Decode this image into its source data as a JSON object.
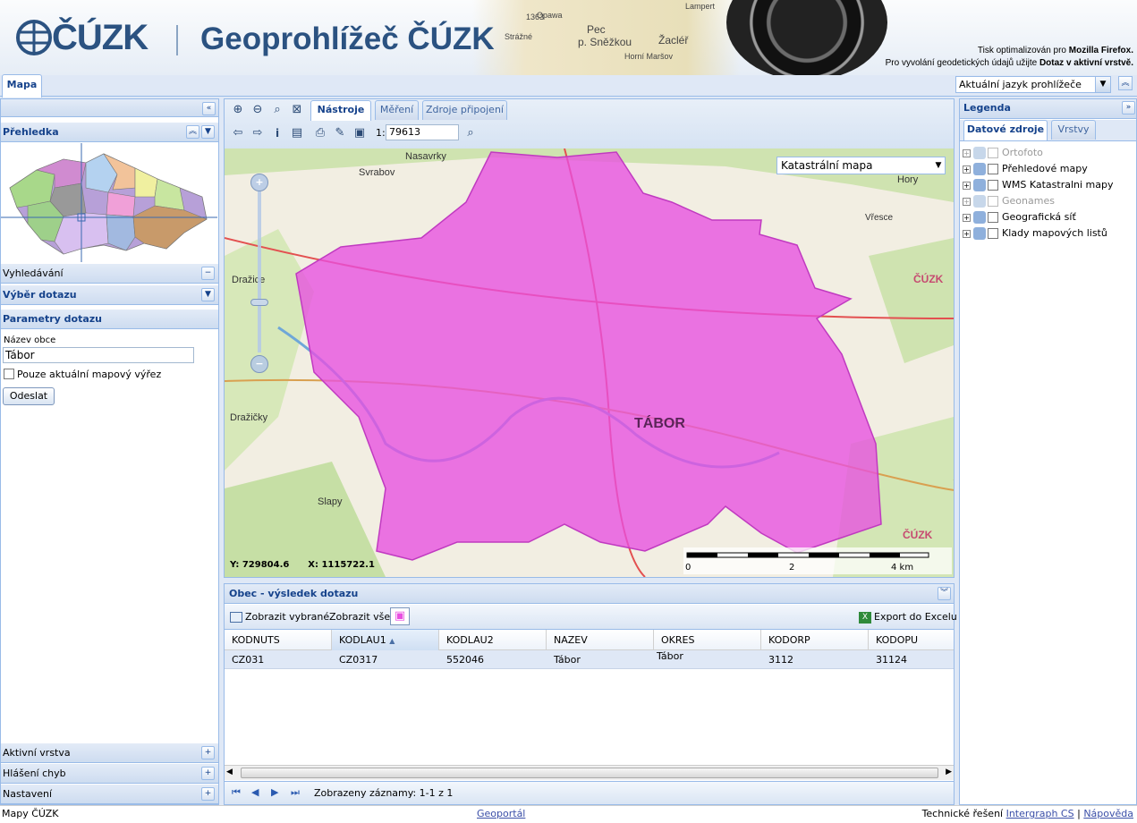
{
  "header": {
    "logo_text": "ČÚZK",
    "title": "Geoprohlížeč ČÚZK",
    "map_labels": [
      "Pec",
      "p. Sněžkou",
      "Strážné",
      "1363",
      "Žacléř",
      "Horní Maršov",
      "Opawa",
      "Lampert"
    ],
    "note_line1_prefix": "Tisk optimalizován pro ",
    "note_line1_bold": "Mozilla Firefox.",
    "note_line2_prefix": "Pro vyvolání geodetických údajů užijte ",
    "note_line2_bold": "Dotaz v aktivní vrstvě."
  },
  "main_tab": "Mapa",
  "language_select": "Aktuální jazyk prohlížeče",
  "left": {
    "overview_title": "Přehledka",
    "search_title": "Vyhledávání",
    "query_select_title": "Výběr dotazu",
    "params_title": "Parametry dotazu",
    "field_label": "Název obce",
    "field_value": "Tábor",
    "checkbox_label": "Pouze aktuální mapový výřez",
    "submit_label": "Odeslat",
    "bottom_panels": [
      "Aktivní vrstva",
      "Hlášení chyb",
      "Nastavení"
    ]
  },
  "center": {
    "tabs": [
      "Nástroje",
      "Měření",
      "Zdroje připojení"
    ],
    "scale_prefix": "1:",
    "scale_value": "79613",
    "layer_select": "Katastrální mapa",
    "coord_y": "Y: 729804.6",
    "coord_x": "X: 1115722.1",
    "scalebar_labels": [
      "0",
      "2",
      "4 km"
    ],
    "map_labels": [
      "TÁBOR",
      "Nasavrky",
      "Svrabov",
      "Dražice",
      "Dražičky",
      "Slapy",
      "Hory",
      "Vřesce",
      "ČÚZK",
      "ČÚZK"
    ]
  },
  "results": {
    "title": "Obec - výsledek dotazu",
    "show_selected": "Zobrazit vybrané",
    "show_all": "Zobrazit vše",
    "export": "Export do Excelu",
    "columns": [
      "KODNUTS",
      "KODLAU1",
      "KODLAU2",
      "NAZEV",
      "OKRES",
      "KODORP",
      "KODOPU"
    ],
    "rows": [
      [
        "CZ031",
        "CZ0317",
        "552046",
        "Tábor",
        "Tábor",
        "3112",
        "31124"
      ]
    ],
    "pager_text": "Zobrazeny záznamy: 1-1 z 1"
  },
  "right": {
    "title": "Legenda",
    "tabs": [
      "Datové zdroje",
      "Vrstvy"
    ],
    "items": [
      {
        "label": "Ortofoto",
        "disabled": true
      },
      {
        "label": "Přehledové mapy",
        "disabled": false
      },
      {
        "label": "WMS Katastralni mapy",
        "disabled": false
      },
      {
        "label": "Geonames",
        "disabled": true
      },
      {
        "label": "Geografická síť",
        "disabled": false
      },
      {
        "label": "Klady mapových listů",
        "disabled": false
      }
    ]
  },
  "footer": {
    "left": "Mapy ČÚZK",
    "center_link": "Geoportál",
    "right_prefix": "Technické řešení ",
    "right_link": "Intergraph CS",
    "separator": "|",
    "help_link": "Nápověda"
  },
  "colors": {
    "accent": "#15428b",
    "brand": "#2b5281",
    "highlight": "#e84fe0"
  }
}
